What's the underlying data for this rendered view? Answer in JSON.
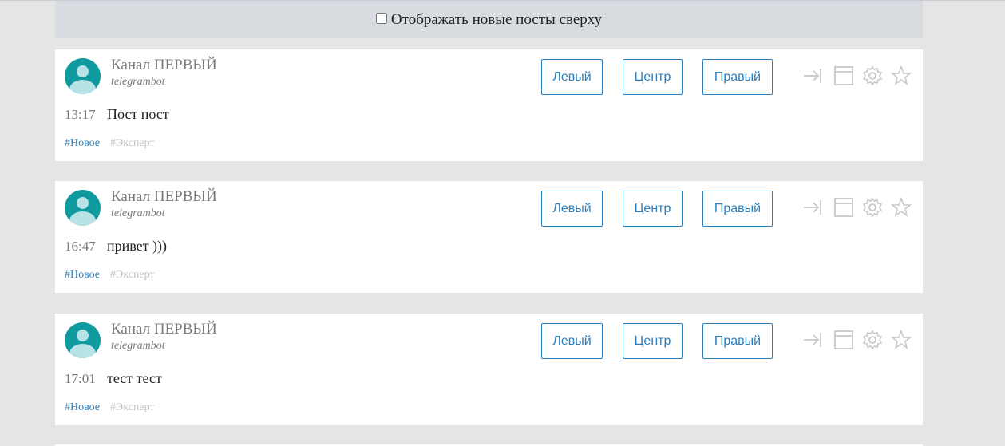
{
  "topbar": {
    "checkbox_label": "Отображать новые посты сверху",
    "checked": false
  },
  "posts": [
    {
      "channel": "Канал ПЕРВЫЙ",
      "user": "telegrambot",
      "time": "13:17",
      "text": "Пост пост",
      "tags": [
        "#Новое",
        "#Эксперт"
      ]
    },
    {
      "channel": "Канал ПЕРВЫЙ",
      "user": "telegrambot",
      "time": "16:47",
      "text": "привет )))",
      "tags": [
        "#Новое",
        "#Эксперт"
      ]
    },
    {
      "channel": "Канал ПЕРВЫЙ",
      "user": "telegrambot",
      "time": "17:01",
      "text": "тест тест",
      "tags": [
        "#Новое",
        "#Эксперт"
      ]
    }
  ],
  "buttons": {
    "left": "Левый",
    "center": "Центр",
    "right": "Правый"
  },
  "icons": [
    "send-to-end-icon",
    "window-icon",
    "gear-icon",
    "star-icon"
  ],
  "colors": {
    "accent": "#2b7fbd",
    "avatar": "#0f9aa0",
    "muted_tag": "#c4c4c4",
    "topbar_bg": "#d8dce0"
  }
}
